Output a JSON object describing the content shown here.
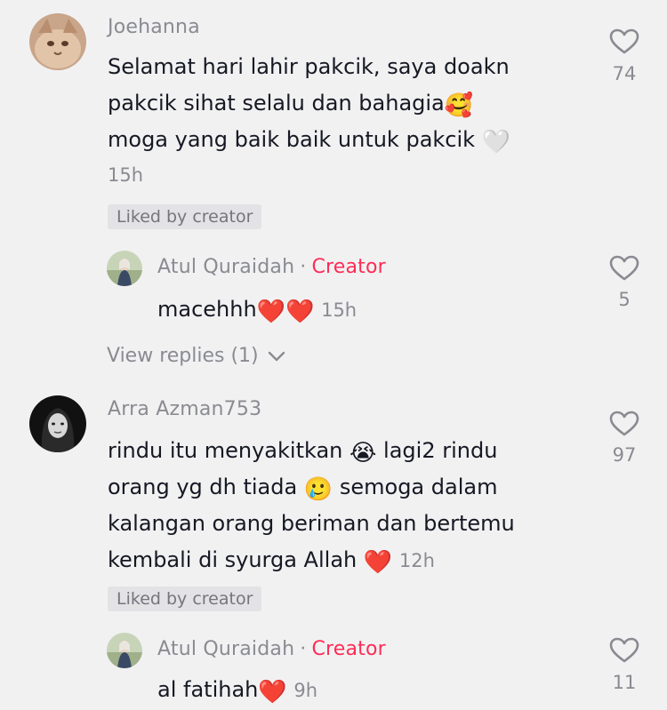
{
  "comments": [
    {
      "username": "Joehanna",
      "lines": [
        "Selamat hari lahir pakcik, saya doakn",
        "pakcik sihat selalu dan bahagia",
        "moga yang baik baik untuk pakcik"
      ],
      "emoji_line2": "🥰",
      "emoji_line3": "🤍",
      "time": "15h",
      "badge": "Liked by creator",
      "likes": "74",
      "avatar_icon": "cat-avatar",
      "reply": {
        "username": "Atul Quraidah",
        "separator": "·",
        "creator_label": "Creator",
        "text": "macehhh",
        "emojis": "❤️❤️",
        "time": "15h",
        "likes": "5",
        "avatar_icon": "girl-avatar"
      },
      "view_replies": "View replies (1)"
    },
    {
      "username": "Arra Azman753",
      "lines": [
        "rindu itu menyakitkan",
        "orang yg dh tiada",
        "kalangan orang beriman dan bertemu",
        "kembali di syurga Allah"
      ],
      "emoji_line1": "😭",
      "line1_suffix": "lagi2 rindu",
      "emoji_line2": "🥲",
      "line2_suffix": "semoga dalam",
      "emoji_line4": "❤️",
      "time": "12h",
      "badge": "Liked by creator",
      "likes": "97",
      "avatar_icon": "woman-avatar",
      "reply": {
        "username": "Atul Quraidah",
        "separator": "·",
        "creator_label": "Creator",
        "text": "al fatihah",
        "emojis": "❤️",
        "time": "9h",
        "likes": "11",
        "avatar_icon": "girl-avatar"
      }
    }
  ],
  "colors": {
    "background": "#f1f1f2",
    "creator": "#fe2c55",
    "secondary": "#8a8b91",
    "text": "#161823"
  }
}
